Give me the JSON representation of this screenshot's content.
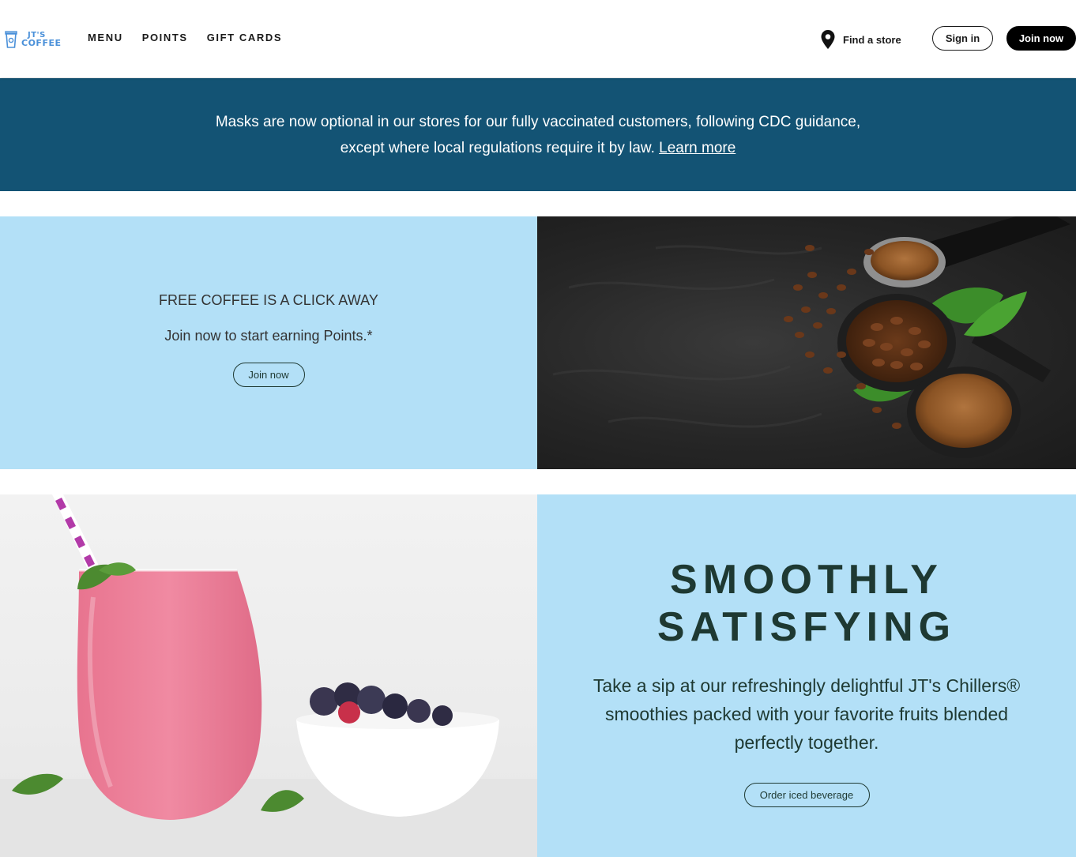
{
  "header": {
    "logo_line1": "JT'S",
    "logo_line2": "COFFEE",
    "nav": [
      {
        "label": "MENU"
      },
      {
        "label": "POINTS"
      },
      {
        "label": "GIFT CARDS"
      }
    ],
    "find_store": "Find a store",
    "sign_in": "Sign in",
    "join_now": "Join now"
  },
  "banner": {
    "line1": "Masks are now optional in our stores for our fully vaccinated customers, following CDC guidance,",
    "line2": "except where local regulations require it by law.",
    "link": "Learn more"
  },
  "promo_points": {
    "heading": "FREE COFFEE IS A CLICK AWAY",
    "subtext": "Join now to start earning Points.*",
    "button": "Join now"
  },
  "promo_smoothie": {
    "title_line1": "SMOOTHLY",
    "title_line2": "SATISFYING",
    "body": "Take a sip at our refreshingly delightful JT's Chillers® smoothies packed with your favorite fruits blended perfectly together.",
    "button": "Order iced beverage"
  },
  "colors": {
    "banner_bg": "#135374",
    "promo_bg": "#b3e0f7",
    "text_dark": "#1e3932",
    "logo_blue": "#4a90d9"
  },
  "icons": {
    "logo": "coffee-cup-icon",
    "find_store": "map-pin-icon"
  }
}
